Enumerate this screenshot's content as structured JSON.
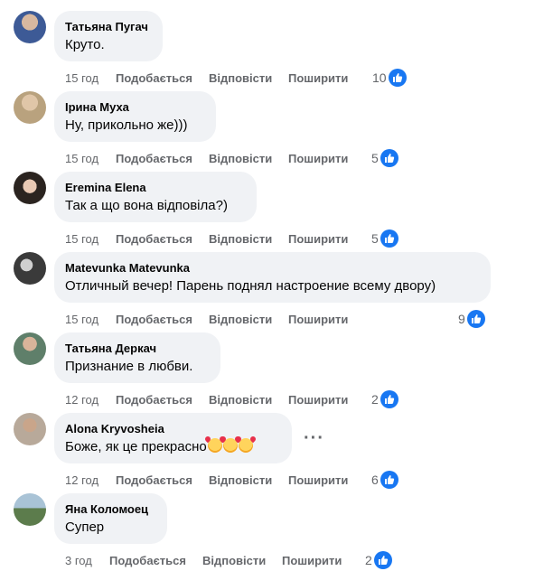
{
  "actions": {
    "like_label": "Подобається",
    "reply_label": "Відповісти",
    "share_label": "Поширити"
  },
  "colors": {
    "bubble": "#f0f2f5",
    "meta_text": "#65676b",
    "like_blue": "#1877f2"
  },
  "comments": [
    {
      "author": "Татьяна Пугач",
      "text": "Круто.",
      "time": "15 год",
      "likes": "10",
      "avatar_color": "#3d5a96"
    },
    {
      "author": "Ірина Муха",
      "text": "Ну, прикольно же)))",
      "time": "15 год",
      "likes": "5",
      "avatar_color": "#b9a27e"
    },
    {
      "author": "Eremina Elena",
      "text": "Так а що вона відповіла?)",
      "time": "15 год",
      "likes": "5",
      "avatar_color": "#2b2420"
    },
    {
      "author": "Matevunka Matevunka",
      "text": "Отличный вечер! Парень поднял настроение всему двору)",
      "time": "15 год",
      "likes": "9",
      "avatar_color": "#3a3a3a"
    },
    {
      "author": "Татьяна Деркач",
      "text": "Признание в любви.",
      "time": "12 год",
      "likes": "2",
      "avatar_color": "#5f7f6a"
    },
    {
      "author": "Alona Kryvosheia",
      "text": "Боже, як це прекрасно",
      "time": "12 год",
      "likes": "6",
      "avatar_color": "#b8a99a",
      "emoji": "smiling-face-with-hearts-emoji"
    },
    {
      "author": "Яна Коломоец",
      "text": "Супер",
      "time": "3 год",
      "likes": "2",
      "avatar_color": "#5c7c4c"
    }
  ]
}
